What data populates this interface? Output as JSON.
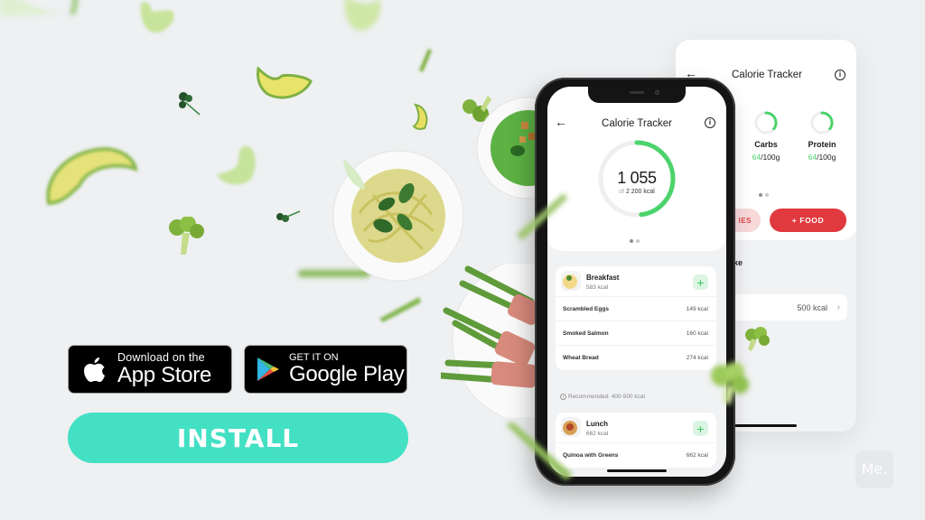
{
  "badges": {
    "apple": {
      "small": "Download on the",
      "big": "App Store",
      "icon": "apple-logo-icon"
    },
    "google": {
      "small": "GET IT ON",
      "big": "Google Play",
      "icon": "google-play-logo-icon"
    }
  },
  "install_button": {
    "label": "INSTALL",
    "color": "#43e0c4"
  },
  "watermark": {
    "label": "Me."
  },
  "back_screen": {
    "title": "Calorie Tracker",
    "back_icon": "arrow-left-icon",
    "info_icon": "info-icon",
    "macros": [
      {
        "name": "Carbs",
        "current": "64",
        "target": "/100g",
        "progress": 0.64
      },
      {
        "name": "Protein",
        "current": "64",
        "target": "/100g",
        "progress": 0.64
      }
    ],
    "buttons": {
      "secondary_partial": "IES",
      "primary": "+ FOOD"
    },
    "section_partial": "ke",
    "row": {
      "value": "500 kcal",
      "chevron": "›"
    },
    "accent_red": "#e0393e"
  },
  "front_screen": {
    "title": "Calorie Tracker",
    "back_icon": "arrow-left-icon",
    "info_icon": "info-icon",
    "consumed": "1 055",
    "of_label": "of",
    "goal": "2 200 kcal",
    "progress": 0.48,
    "accent_green": "#4cd36b",
    "meals": [
      {
        "name": "Breakfast",
        "kcal": "583 kcal",
        "items": [
          {
            "name": "Scrambled Eggs",
            "kcal": "149 kcal"
          },
          {
            "name": "Smoked Salmon",
            "kcal": "160 kcal"
          },
          {
            "name": "Wheat Bread",
            "kcal": "274 kcal"
          }
        ]
      },
      {
        "name": "Lunch",
        "kcal": "662 kcal",
        "items": [
          {
            "name": "Quinoa with Greens",
            "kcal": "662 kcal"
          }
        ]
      }
    ],
    "recommended": "Recommended: 400-500 kcal",
    "add_label": "+"
  }
}
